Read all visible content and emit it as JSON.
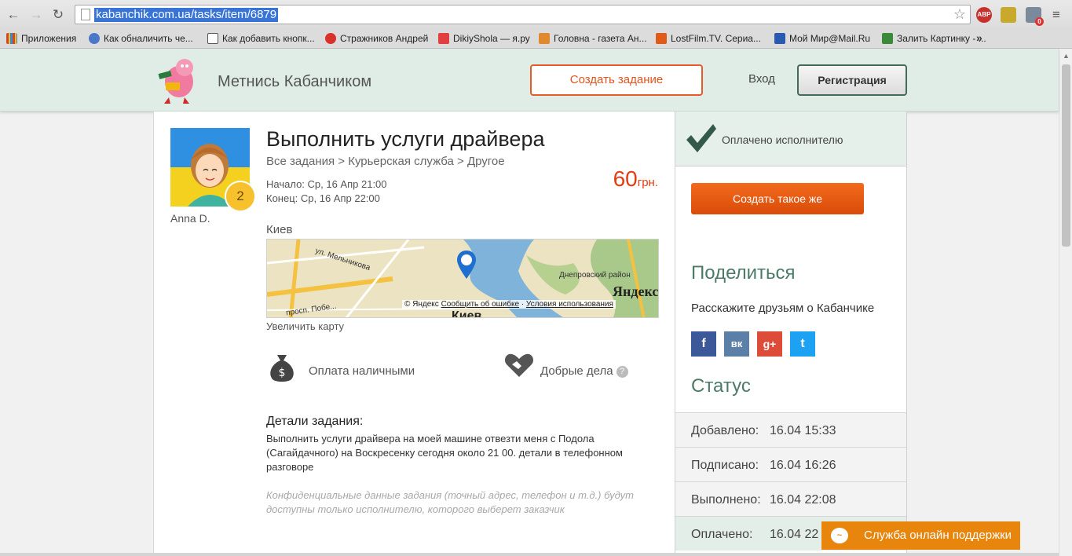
{
  "browser": {
    "url": "kabanchik.com.ua/tasks/item/6879",
    "bookmarks": [
      {
        "label": "Приложения",
        "color": "#d04a2a"
      },
      {
        "label": "Как обналичить че...",
        "color": "#4a78c8"
      },
      {
        "label": "Как добавить кнопк...",
        "color": "#333333"
      },
      {
        "label": "Стражников Андрей",
        "color": "#d8322a"
      },
      {
        "label": "DikiyShola — я.ру",
        "color": "#e04040"
      },
      {
        "label": "Головна - газета Ан...",
        "color": "#e08a30"
      },
      {
        "label": "LostFilm.TV. Сериа...",
        "color": "#e05a1a"
      },
      {
        "label": "Мой Мир@Mail.Ru",
        "color": "#2a5ab0"
      },
      {
        "label": "Залить Картинку - ...",
        "color": "#3a8a3a"
      }
    ],
    "more": "»",
    "ext_abp": "ABP",
    "ext_badge": "0"
  },
  "header": {
    "brand": "Метнись Кабанчиком",
    "create_task": "Создать задание",
    "login": "Вход",
    "register": "Регистрация"
  },
  "task": {
    "author": "Anna D.",
    "badge": "2",
    "title": "Выполнить услуги драйвера",
    "breadcrumb": "Все задания > Курьерская служба > Другое",
    "start": "Начало: Ср, 16 Апр 21:00",
    "end": "Конец: Ср, 16 Апр 22:00",
    "price": "60",
    "currency": "грн.",
    "city": "Киев",
    "map": {
      "street1": "ул. Мельникова",
      "district": "Днепровский район",
      "street2": "просп. Побе...",
      "copyright": "© Яндекс",
      "report": "Сообщить об ошибке",
      "terms": "Условия использования",
      "logo": "Яндекс",
      "city_label": "Киев"
    },
    "enlarge": "Увеличить карту",
    "payment": "Оплата наличными",
    "good_deeds": "Добрые дела",
    "help": "?",
    "details_title": "Детали задания:",
    "details": "Выполнить услуги драйвера на моей машине отвезти меня с Подола (Сагайдачного) на Воскресенку сегодня около 21 00. детали в телефонном разговоре",
    "confidential": "Конфиденциальные данные задания (точный адрес, телефон и т.д.) будут доступны только исполнителю, которого выберет заказчик"
  },
  "sidebar": {
    "paid": "Оплачено исполнителю",
    "create_same": "Создать такое же",
    "share_title": "Поделиться",
    "share_text": "Расскажите друзьям о Кабанчике",
    "socials": [
      {
        "name": "facebook",
        "glyph": "f",
        "color": "#3b5998"
      },
      {
        "name": "vkontakte",
        "glyph": "вк",
        "color": "#5b7fa6"
      },
      {
        "name": "google-plus",
        "glyph": "g+",
        "color": "#dd4b39"
      },
      {
        "name": "twitter",
        "glyph": "t",
        "color": "#1da1f2"
      }
    ],
    "status_title": "Статус",
    "status": [
      {
        "label": "Добавлено:",
        "value": "16.04 15:33"
      },
      {
        "label": "Подписано:",
        "value": "16.04 16:26"
      },
      {
        "label": "Выполнено:",
        "value": "16.04 22:08"
      },
      {
        "label": "Оплачено:",
        "value": "16.04 22"
      }
    ]
  },
  "support": {
    "label": "Служба онлайн поддержки"
  }
}
